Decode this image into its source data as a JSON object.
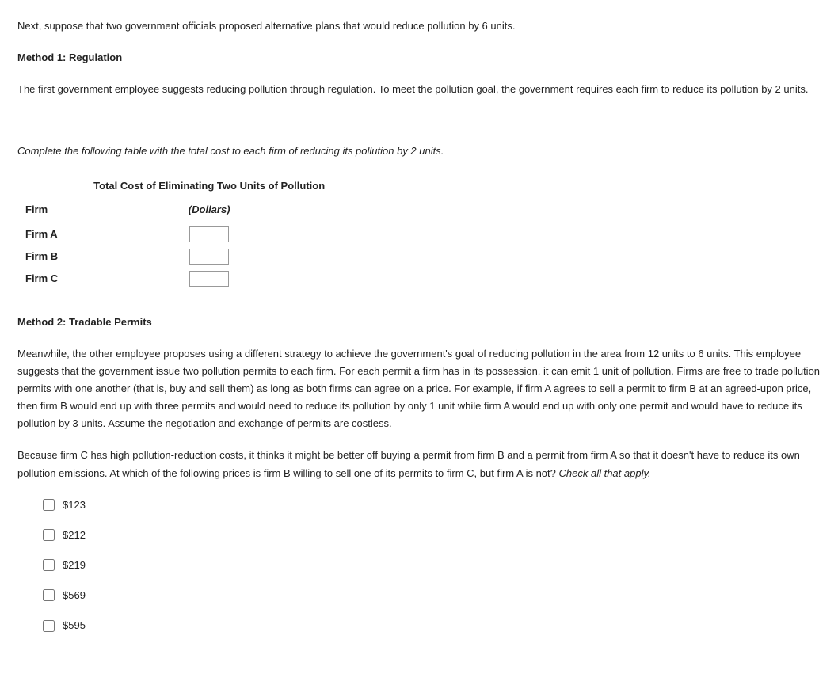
{
  "intro": "Next, suppose that two government officials proposed alternative plans that would reduce pollution by 6 units.",
  "method1": {
    "title": "Method 1: Regulation",
    "desc": "The first government employee suggests reducing pollution through regulation. To meet the pollution goal, the government requires each firm to reduce its pollution by 2 units.",
    "table_prompt": "Complete the following table with the total cost to each firm of reducing its pollution by 2 units.",
    "table": {
      "col1": "Firm",
      "col2_main": "Total Cost of Eliminating Two Units of Pollution",
      "col2_sub": "(Dollars)",
      "rows": [
        {
          "label": "Firm A",
          "value": ""
        },
        {
          "label": "Firm B",
          "value": ""
        },
        {
          "label": "Firm C",
          "value": ""
        }
      ]
    }
  },
  "method2": {
    "title": "Method 2: Tradable Permits",
    "desc": "Meanwhile, the other employee proposes using a different strategy to achieve the government's goal of reducing pollution in the area from 12 units to 6 units. This employee suggests that the government issue two pollution permits to each firm. For each permit a firm has in its possession, it can emit 1 unit of pollution. Firms are free to trade pollution permits with one another (that is, buy and sell them) as long as both firms can agree on a price. For example, if firm A agrees to sell a permit to firm B at an agreed-upon price, then firm B would end up with three permits and would need to reduce its pollution by only 1 unit while firm A would end up with only one permit and would have to reduce its pollution by 3 units. Assume the negotiation and exchange of permits are costless.",
    "question_part1": "Because firm C has high pollution-reduction costs, it thinks it might be better off buying a permit from firm B and a permit from firm A so that it doesn't have to reduce its own pollution emissions. At which of the following prices is firm B willing to sell one of its permits to firm C, but firm A is not? ",
    "question_check": "Check all that apply.",
    "options": [
      "$123",
      "$212",
      "$219",
      "$569",
      "$595"
    ]
  }
}
